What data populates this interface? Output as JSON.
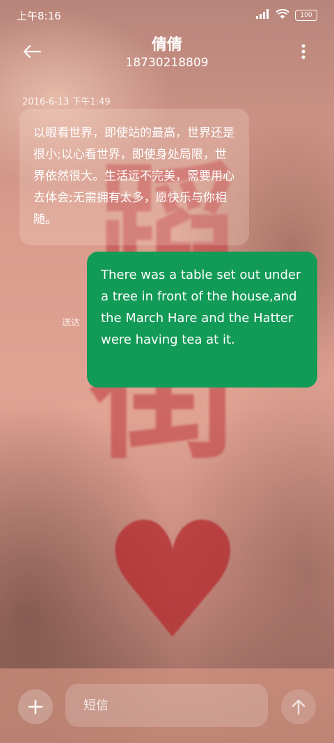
{
  "status_bar": {
    "time": "上午8:16",
    "battery": "100",
    "icons": [
      "signal-icon",
      "wifi-icon",
      "battery-icon"
    ]
  },
  "header": {
    "contact_name": "倩倩",
    "phone_number": "18730218809",
    "icons": [
      "back-arrow-icon",
      "more-vertical-icon"
    ]
  },
  "conversation": {
    "timestamp": "2016-6-13 下午1:49",
    "incoming_message": "以眼看世界，即使站的最高，世界还是很小;以心看世界，即使身处局限，世界依然很大。生活远不完美，需要用心去体会;无需拥有太多，愿快乐与你相随。",
    "outgoing_message": "There was a table set out under a tree in front of the house,and the March Hare and the Hatter were having tea at it.",
    "delivery_status": "送达"
  },
  "composer": {
    "placeholder": "短信",
    "value": "",
    "icons": [
      "plus-icon",
      "send-arrow-icon"
    ]
  },
  "colors": {
    "outgoing_bubble": "#129a57",
    "text": "#ffffff"
  }
}
